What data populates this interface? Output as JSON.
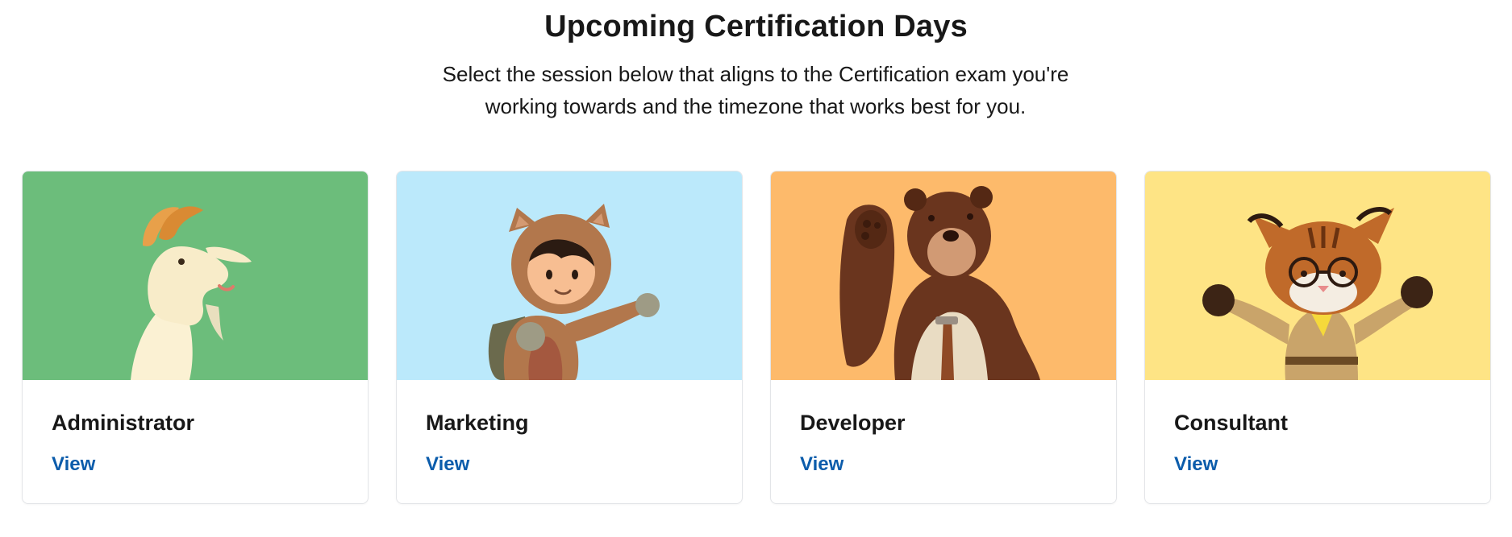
{
  "header": {
    "title": "Upcoming Certification Days",
    "subtitle_line1": "Select the session below that aligns to the Certification exam you're",
    "subtitle_line2": "working towards and the timezone that works best for you."
  },
  "cards": [
    {
      "title": "Administrator",
      "link": "View",
      "bg": "#6cbd7b",
      "icon": "goat-mascot"
    },
    {
      "title": "Marketing",
      "link": "View",
      "bg": "#bbe9fb",
      "icon": "astro-mascot"
    },
    {
      "title": "Developer",
      "link": "View",
      "bg": "#fdba6b",
      "icon": "bear-mascot"
    },
    {
      "title": "Consultant",
      "link": "View",
      "bg": "#fee485",
      "icon": "lynx-mascot"
    }
  ],
  "colors": {
    "link": "#0b5cab",
    "text": "#181818",
    "border": "#e3e5e8"
  }
}
